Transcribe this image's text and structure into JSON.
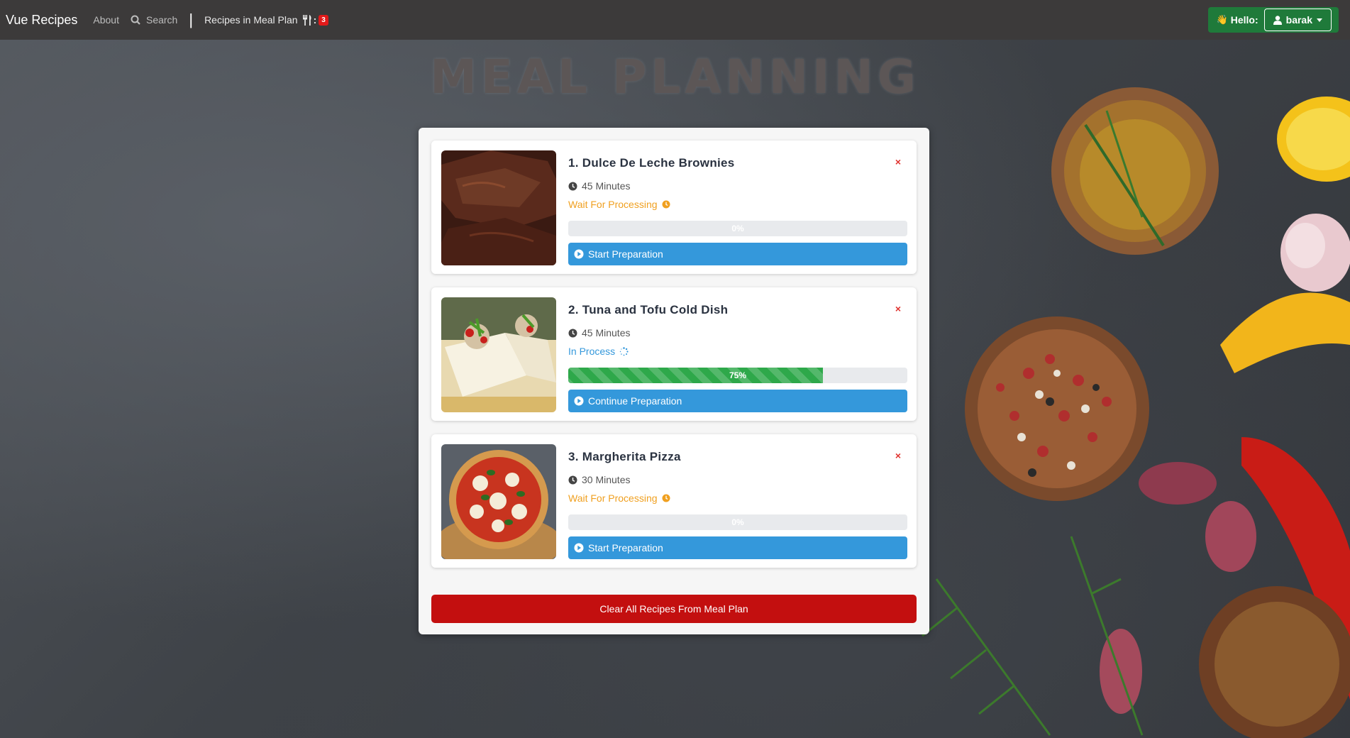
{
  "navbar": {
    "brand": "Vue Recipes",
    "about": "About",
    "search": "Search",
    "separator": "|",
    "meal_plan": "Recipes in Meal Plan",
    "meal_plan_colon": ":",
    "meal_plan_count": "3",
    "hello": "Hello:",
    "username": "barak",
    "icons": [
      "search-icon",
      "utensils-icon",
      "waving-hand-icon",
      "user-icon",
      "caret-down-icon"
    ]
  },
  "page": {
    "title": "MEAL PLANNING"
  },
  "recipes": [
    {
      "title": "1. Dulce De Leche Brownies",
      "remove": "×",
      "time": "45 Minutes",
      "status": "Wait For Processing",
      "progress_value": 0,
      "progress_label": "0%",
      "action": "Start Preparation"
    },
    {
      "title": "2. Tuna and Tofu Cold Dish",
      "remove": "×",
      "time": "45 Minutes",
      "status": "In Process",
      "progress_value": 75,
      "progress_label": "75%",
      "action": "Continue Preparation"
    },
    {
      "title": "3. Margherita Pizza",
      "remove": "×",
      "time": "30 Minutes",
      "status": "Wait For Processing",
      "progress_value": 0,
      "progress_label": "0%",
      "action": "Start Preparation"
    }
  ],
  "clear_button": "Clear All Recipes From Meal Plan",
  "colors": {
    "navbar": "#3c3a3a",
    "user_area": "#1f7a3a",
    "primary": "#3498db",
    "warning": "#f0a020",
    "success": "#2ea84a",
    "danger": "#c30f0f",
    "badge": "#e21a1a"
  }
}
